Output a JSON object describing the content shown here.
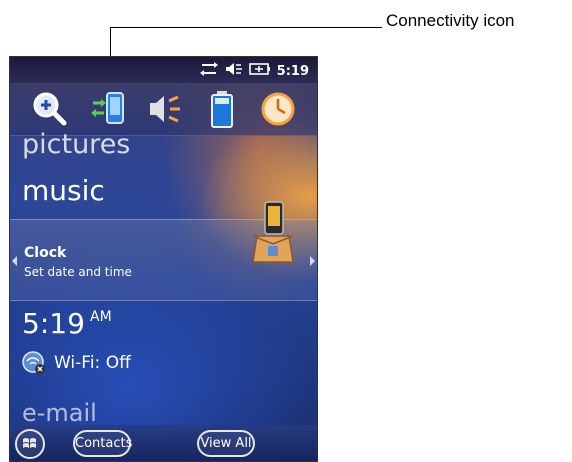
{
  "callout": {
    "label": "Connectivity icon"
  },
  "status_bar": {
    "icons": [
      "connectivity-icon",
      "speaker-muted-icon",
      "battery-charging-icon"
    ],
    "time": "5:19"
  },
  "quick_bar": {
    "icons": [
      "zoom-icon",
      "phone-connection-icon",
      "volume-icon",
      "battery-icon",
      "clock-icon"
    ]
  },
  "tiles": {
    "pictures": "pictures",
    "music": "music",
    "email": "e-mail"
  },
  "clock_panel": {
    "title": "Clock",
    "subtitle": "Set date and time"
  },
  "home": {
    "time": "5:19",
    "ampm": "AM",
    "wifi": "Wi-Fi: Off"
  },
  "softkeys": {
    "left": "Contacts",
    "right": "View All"
  },
  "colors": {
    "accent_orange": "#f7a23c",
    "screen_blue": "#223f8f"
  }
}
